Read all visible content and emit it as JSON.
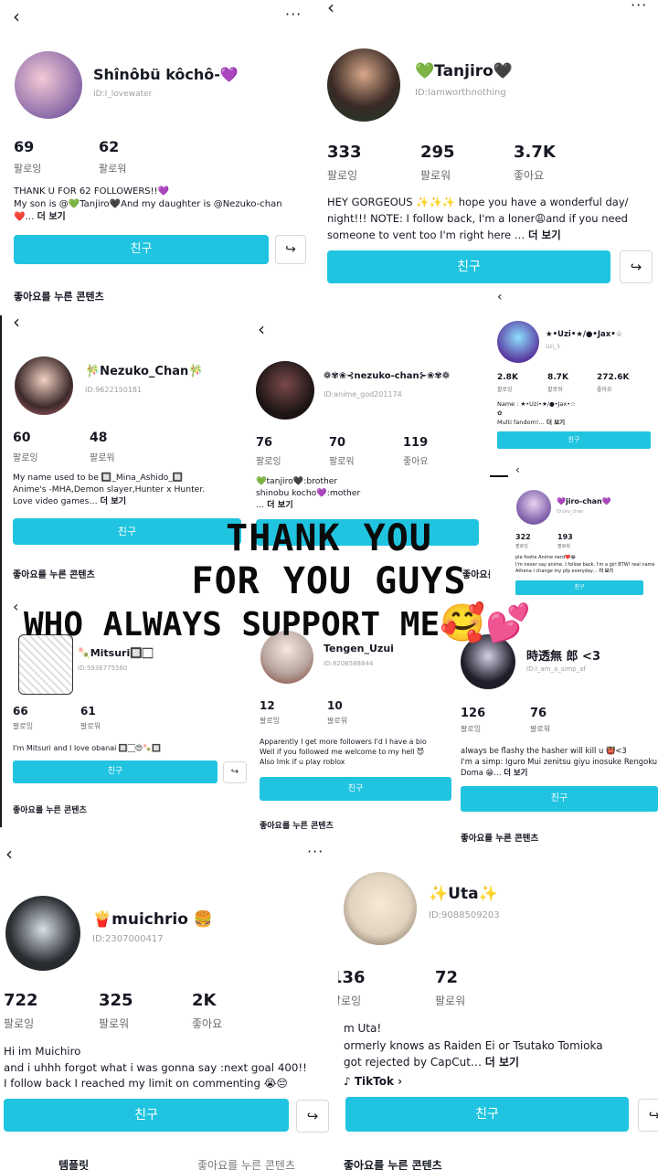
{
  "p1": {
    "back": "‹",
    "more": "···",
    "name": "Shînôbü kôchô-💜",
    "id": "ID:I_lovewater",
    "stats": [
      {
        "n": "69",
        "l": "팔로잉"
      },
      {
        "n": "62",
        "l": "팔로워"
      }
    ],
    "bio": [
      "THANK U FOR 62 FOLLOWERS!!💜",
      "My son is @💚Tanjiro🖤And my daughter is @Nezuko-chan",
      "❤️… "
    ],
    "more_text": "더 보기",
    "button": "친구",
    "share": "↪",
    "liked": "좋아요를 누른 콘텐츠"
  },
  "p2": {
    "back": "‹",
    "more": "···",
    "name": "💚Tanjiro🖤",
    "id": "ID:Iamworthnothing",
    "stats": [
      {
        "n": "333",
        "l": "팔로잉"
      },
      {
        "n": "295",
        "l": "팔로워"
      },
      {
        "n": "3.7K",
        "l": "좋아요"
      }
    ],
    "bio": [
      "HEY GORGEOUS ✨✨✨ hope you have a wonderful day/",
      "night!!! NOTE: I follow back, I'm a loner😩and if you need",
      "someone to vent too I'm right here … "
    ],
    "more_text": "더 보기",
    "button": "친구",
    "share": "↪"
  },
  "p3": {
    "back": "‹",
    "name": "🎋Nezuko_Chan🎋",
    "id": "ID:9622150181",
    "stats": [
      {
        "n": "60",
        "l": "팔로잉"
      },
      {
        "n": "48",
        "l": "팔로워"
      }
    ],
    "bio": [
      "My name used to be 🔲_Mina_Ashido_🔲",
      "Anime's -MHA,Demon slayer,Hunter x Hunter.",
      "Love video games… "
    ],
    "more_text": "더 보기",
    "button": "친구",
    "liked": "좋아요를 누른 콘텐츠"
  },
  "p4": {
    "back": "‹",
    "name": "❁✾❀⊰nezuko-chan⊱❀✾❁",
    "id": "ID:anime_god201174",
    "stats": [
      {
        "n": "76",
        "l": "팔로잉"
      },
      {
        "n": "70",
        "l": "팔로워"
      },
      {
        "n": "119",
        "l": "좋아요"
      }
    ],
    "bio": [
      "💚tanjiro🖤:brother",
      "shinobu kocho💜:mother",
      "… "
    ],
    "more_text": "더 보기",
    "liked": "좋아요를 누른 콘텐츠"
  },
  "p5": {
    "back": "‹",
    "name": "★•Uzi•★/●•Jax•☆",
    "id": "Uzi_5",
    "stats": [
      {
        "n": "2.8K",
        "l": "팔로잉"
      },
      {
        "n": "8.7K",
        "l": "팔로워"
      },
      {
        "n": "272.6K",
        "l": "좋아요"
      }
    ],
    "bio": [
      "Name : ★•Uzi•★/●•Jax•☆",
      "✿",
      "Multi fandom!… "
    ],
    "more_text": "더 보기",
    "button": "친구"
  },
  "p6": {
    "back": "‹",
    "name": "💜jiro-chan💜",
    "id": "ID:jiro_chan",
    "stats": [
      {
        "n": "322",
        "l": "팔로잉"
      },
      {
        "n": "193",
        "l": "팔로워"
      }
    ],
    "bio": [
      "ple footie Anime nerd❤️😂",
      "I'm never say anime. I follow back. I'm a girl BTW! real name",
      "Athena I change my pfp everyday… "
    ],
    "more_text": "더 보기",
    "button": "친구"
  },
  "p7": {
    "back": "‹",
    "name": "🍡Mitsuri🔲🏻",
    "id": "ID:5936775560",
    "stats": [
      {
        "n": "66",
        "l": "팔로잉"
      },
      {
        "n": "61",
        "l": "팔로워"
      }
    ],
    "bio": [
      "I'm Mitsuri and I love obanai 🔲🏻😍🍡🔲"
    ],
    "button": "친구",
    "share": "↪",
    "liked": "좋아요를 누른 콘텐츠"
  },
  "p8": {
    "name": "Tengen_Uzui",
    "id": "ID:8208588844",
    "stats": [
      {
        "n": "12",
        "l": "팔로잉"
      },
      {
        "n": "10",
        "l": "팔로워"
      }
    ],
    "bio": [
      "Apparently I get more followers I'd I have a bio",
      "Well if you followed me welcome to my hell 😈",
      "Also lmk if u play roblox"
    ],
    "button": "친구",
    "liked": "좋아요를 누른 콘텐츠"
  },
  "p9": {
    "name": "時透無 郎 <3",
    "id": "ID:I_am_a_simp_af",
    "stats": [
      {
        "n": "126",
        "l": "팔로잉"
      },
      {
        "n": "76",
        "l": "팔로워"
      }
    ],
    "bio": [
      "always be flashy the hasher will kill u 👹<3",
      "I'm a simp: Iguro Mui zenitsu giyu inosuke Rengoku",
      "Doma 😁… "
    ],
    "more_text": "더 보기",
    "button": "친구",
    "liked": "좋아요를 누른 콘텐츠"
  },
  "p10": {
    "back": "‹",
    "more": "···",
    "name": "🍟muichrio 🍔",
    "id": "ID:2307000417",
    "stats": [
      {
        "n": "722",
        "l": "팔로잉"
      },
      {
        "n": "325",
        "l": "팔로워"
      },
      {
        "n": "2K",
        "l": "좋아요"
      }
    ],
    "bio": [
      "Hi im Muichiro",
      "and i uhhh forgot what i was gonna say :next goal 400!!",
      "I follow back I reached my limit on commenting 😭😔"
    ],
    "button": "친구",
    "share": "↪",
    "tab1": "템플릿",
    "tab2": "좋아요를 누른 콘텐츠"
  },
  "p11": {
    "name": "✨Uta✨",
    "id": "ID:9088509203",
    "stats": [
      {
        "n": "136",
        "l": "팔로잉"
      },
      {
        "n": "72",
        "l": "팔로워"
      }
    ],
    "bio": [
      "m Uta!",
      "ormerly knows as Raiden Ei or Tsutako Tomioka",
      "got rejected by CapCut… "
    ],
    "more_text": "더 보기",
    "tiktok": "♪ TikTok ›",
    "button": "친구",
    "share": "↪",
    "tab": "좋아요를 누른 콘텐츠"
  },
  "overlay": {
    "line1": "THANK YOU",
    "line2": "FOR YOU GUYS",
    "line3": "WHO ALWAYS SUPPORT ME",
    "emoji": "🥰💕"
  }
}
